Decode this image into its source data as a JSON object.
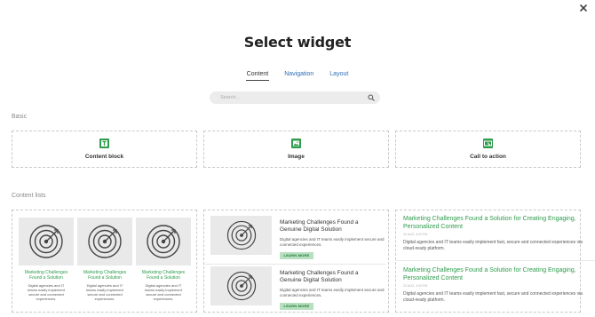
{
  "header": {
    "title": "Select widget"
  },
  "tabs": [
    {
      "label": "Content",
      "active": true
    },
    {
      "label": "Navigation",
      "active": false
    },
    {
      "label": "Layout",
      "active": false
    }
  ],
  "search": {
    "placeholder": "Search..."
  },
  "sections": {
    "basic_label": "Basic",
    "content_lists_label": "Content lists"
  },
  "basic_widgets": [
    {
      "label": "Content block",
      "icon": "text-block-icon"
    },
    {
      "label": "Image",
      "icon": "image-icon"
    },
    {
      "label": "Call to action",
      "icon": "call-to-action-icon"
    }
  ],
  "content_lists": {
    "card1": {
      "items": [
        {
          "title": "Marketing Challenges Found a Solution",
          "desc": "Digital agencies and IT teams easily implement secure and connected experiences."
        },
        {
          "title": "Marketing Challenges Found a Solution",
          "desc": "Digital agencies and IT teams easily implement secure and connected experiences."
        },
        {
          "title": "Marketing Challenges Found a Solution",
          "desc": "Digital agencies and IT teams easily implement secure and connected experiences."
        }
      ]
    },
    "card2": {
      "items": [
        {
          "title": "Marketing Challenges Found a Genuine Digital Solution",
          "desc": "Digital agencies and IT teams easily implement secure and connected experiences.",
          "button": "LEARN MORE"
        },
        {
          "title": "Marketing Challenges Found a Genuine Digital Solution",
          "desc": "Digital agencies and IT teams easily implement secure and connected experiences.",
          "button": "LEARN MORE"
        }
      ]
    },
    "card3": {
      "items": [
        {
          "title": "Marketing Challenges Found a Solution for Creating Engaging, Personalized Content",
          "date": "22 AUG, 3:00 PM",
          "desc": "Digital agencies and IT teams easily implement fast, secure and connected experiences via cloud-ready platform."
        },
        {
          "title": "Marketing Challenges Found a Solution for Creating Engaging, Personalized Content",
          "date": "22 AUG, 3:00 PM",
          "desc": "Digital agencies and IT teams easily implement fast, secure and connected experiences via cloud-ready platform."
        }
      ]
    }
  },
  "colors": {
    "accent": "#2e9c4c",
    "link": "#2f6fb5",
    "placeholder_bg": "#e9e9e9",
    "button_bg": "#b7dfc0"
  }
}
